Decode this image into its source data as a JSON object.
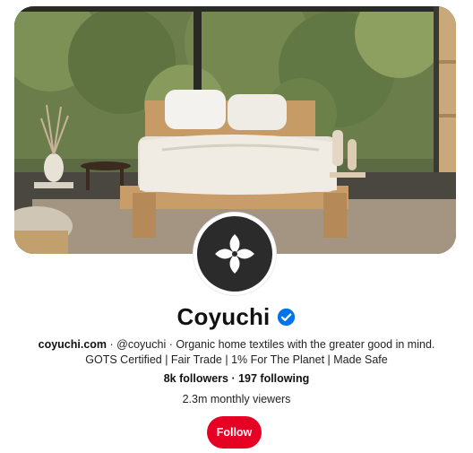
{
  "profile": {
    "name": "Coyuchi",
    "website": "coyuchi.com",
    "bio_rest": " · @coyuchi · Organic home textiles with the greater good in mind. GOTS Certified | Fair Trade | 1% For The Planet | Made Safe",
    "followers": "8k followers",
    "separator": " · ",
    "following": "197 following",
    "monthly_viewers": "2.3m monthly viewers",
    "verified": true
  },
  "actions": {
    "follow_label": "Follow"
  },
  "colors": {
    "accent": "#e60023",
    "verified_badge": "#0074e8"
  },
  "icons": {
    "avatar": "coyuchi-logo-icon",
    "badge": "verified-check-icon"
  }
}
